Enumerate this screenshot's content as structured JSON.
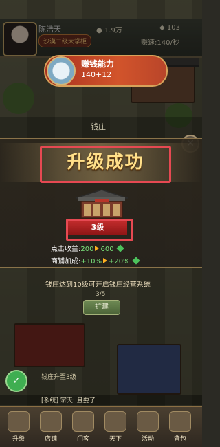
{
  "header": {
    "player_name": "陈浩天",
    "player_title": "沙漠二级大掌柜",
    "money": "1.9万",
    "ingots": "103",
    "speed": "赚速:140/秒"
  },
  "earn_banner": {
    "title": "赚钱能力",
    "value": "140+12"
  },
  "shop_header": {
    "title": "钱庄"
  },
  "popup": {
    "title": "升级成功",
    "level": "3级",
    "stats": [
      {
        "label": "点击收益:",
        "old": "200",
        "new": "600"
      },
      {
        "label": "商铺加成:",
        "old": "+10%",
        "new": "+20%"
      }
    ]
  },
  "lower": {
    "hint": "钱庄达到10级可开启钱庄经营系统",
    "progress": "3/5",
    "expand_label": "扩建",
    "quest": "钱庄升至3级",
    "chat": "[系统] 宗天: 且要了"
  },
  "nav": [
    {
      "label": "升级",
      "icon": "upgrade-icon"
    },
    {
      "label": "店铺",
      "icon": "shop-icon"
    },
    {
      "label": "门客",
      "icon": "guest-icon"
    },
    {
      "label": "天下",
      "icon": "world-icon"
    },
    {
      "label": "活动",
      "icon": "event-icon"
    },
    {
      "label": "背包",
      "icon": "bag-icon"
    }
  ],
  "colors": {
    "accent_red": "#e64952",
    "title_gold": "#ffe08a",
    "stat_green": "#7be37b",
    "arrow_orange": "#ffb11f"
  }
}
